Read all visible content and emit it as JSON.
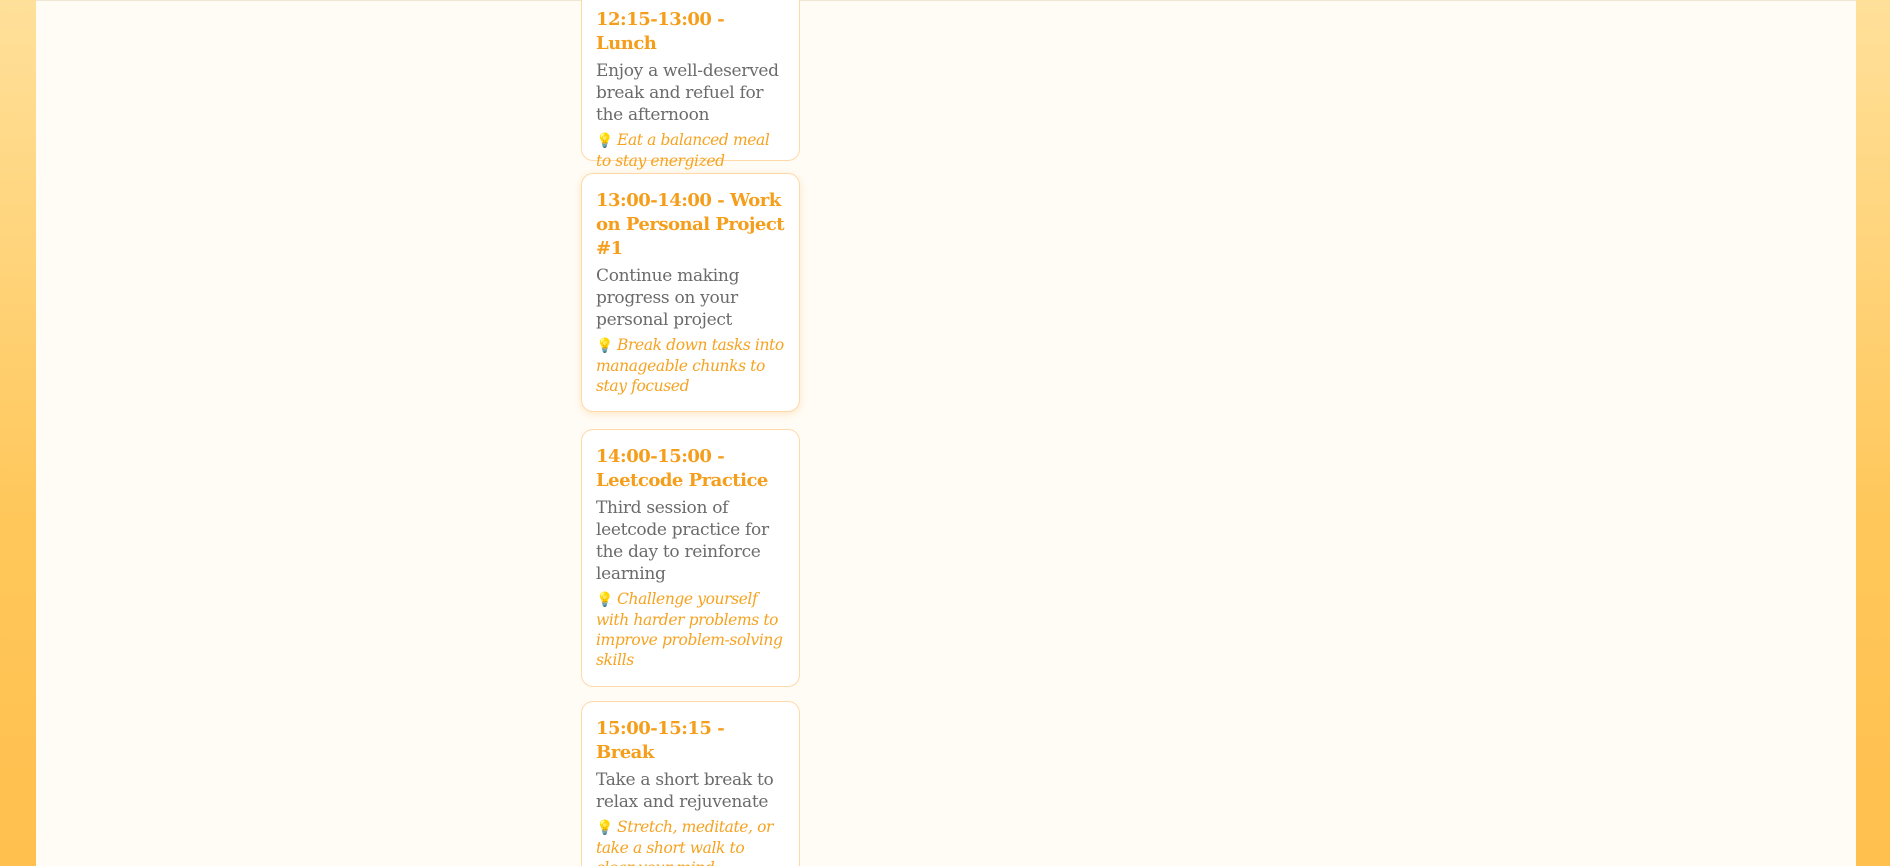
{
  "schedule": [
    {
      "title": "12:15-13:00 - Lunch",
      "description": "Enjoy a well-deserved break and refuel for the afternoon",
      "tip_icon": "lightbulb-icon",
      "tip_glyph": "💡",
      "tip": "Eat a balanced meal to stay energized"
    },
    {
      "title": "13:00-14:00 - Work on Personal Project #1",
      "description": "Continue making progress on your personal project",
      "tip_icon": "lightbulb-icon",
      "tip_glyph": "💡",
      "tip": "Break down tasks into manageable chunks to stay focused"
    },
    {
      "title": "14:00-15:00 - Leetcode Practice",
      "description": "Third session of leetcode practice for the day to reinforce learning",
      "tip_icon": "lightbulb-icon",
      "tip_glyph": "💡",
      "tip": "Challenge yourself with harder problems to improve problem-solving skills"
    },
    {
      "title": "15:00-15:15 - Break",
      "description": "Take a short break to relax and rejuvenate",
      "tip_icon": "lightbulb-icon",
      "tip_glyph": "💡",
      "tip": "Stretch, meditate, or take a short walk to clear your mind"
    }
  ],
  "colors": {
    "accent": "#f59e1b",
    "tip": "#f5a321",
    "text": "#6b6b6b",
    "card_border": "#ffd9a8",
    "page_background": "#fffcf6"
  }
}
